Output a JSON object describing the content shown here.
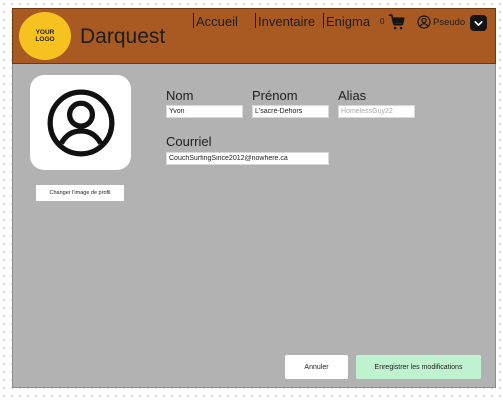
{
  "header": {
    "logo_line1": "YOUR",
    "logo_line2": "LOGO",
    "brand": "Darquest",
    "nav": [
      {
        "label": "Accueil"
      },
      {
        "label": "Inventaire"
      },
      {
        "label": "Enigma"
      }
    ],
    "cart_count": "0",
    "cart_icon": "shopping-cart-icon",
    "user_icon": "user-circle-icon",
    "username": "Pseudo",
    "dropdown_icon": "chevron-down-icon"
  },
  "profile": {
    "avatar_icon": "user-circle-icon",
    "change_image_label": "Changer l'image de profil"
  },
  "form": {
    "nom_label": "Nom",
    "nom_value": "Yvon",
    "prenom_label": "Prénom",
    "prenom_value": "L'sacré-Dehors",
    "alias_label": "Alias",
    "alias_placeholder": "HomelessGuy22",
    "courriel_label": "Courriel",
    "courriel_value": "CouchSurfingSince2012@nowhere.ca"
  },
  "actions": {
    "cancel_label": "Annuler",
    "save_label": "Enregistrer les modifications"
  },
  "colors": {
    "header_bg": "#a85a22",
    "logo_bg": "#f6c21f",
    "content_bg": "#b2b2b2",
    "save_bg": "#bff2cf"
  }
}
